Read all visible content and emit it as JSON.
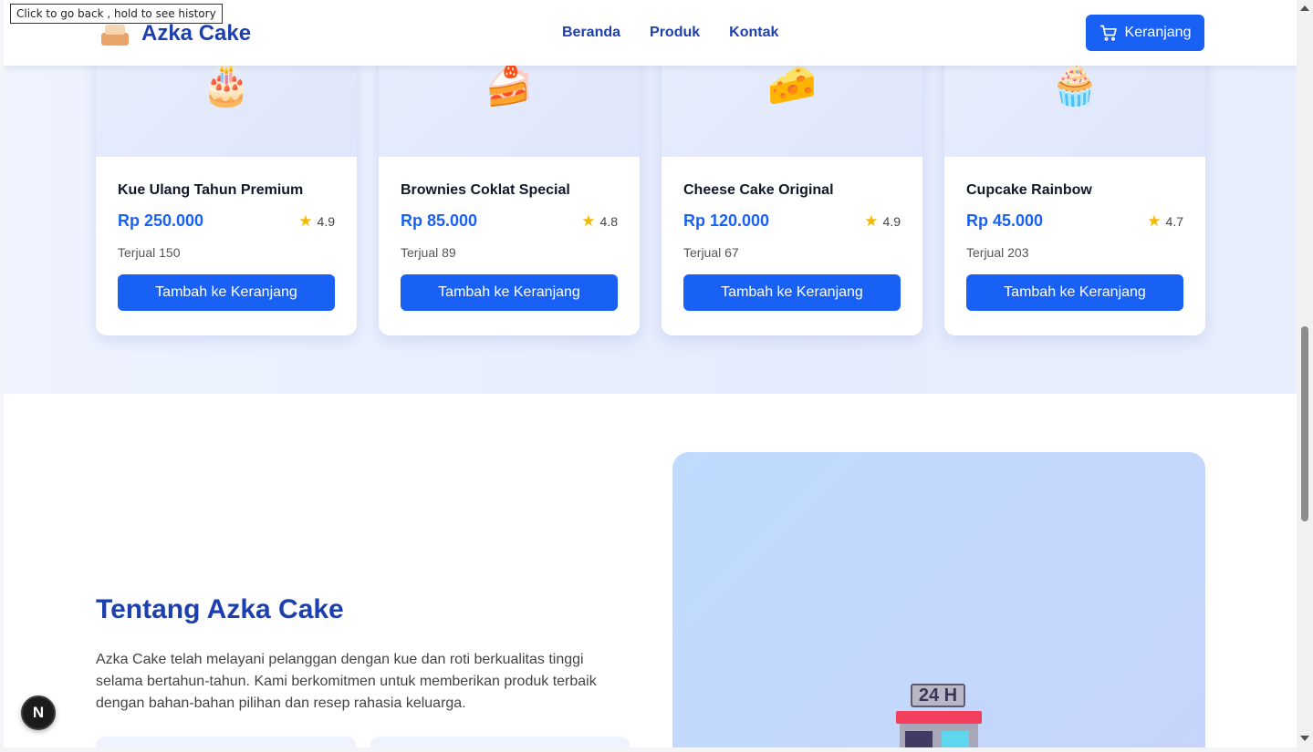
{
  "browser": {
    "tooltip": "Click to go back , hold to see history"
  },
  "header": {
    "brand": "Azka Cake",
    "nav": [
      "Beranda",
      "Produk",
      "Kontak"
    ],
    "cart_label": "Keranjang"
  },
  "products": [
    {
      "name": "Kue Ulang Tahun Premium",
      "price": "Rp 250.000",
      "rating": "4.9",
      "sold": "Terjual 150",
      "button": "Tambah ke Keranjang",
      "emoji": "🎂"
    },
    {
      "name": "Brownies Coklat Special",
      "price": "Rp 85.000",
      "rating": "4.8",
      "sold": "Terjual 89",
      "button": "Tambah ke Keranjang",
      "emoji": "🍰"
    },
    {
      "name": "Cheese Cake Original",
      "price": "Rp 120.000",
      "rating": "4.9",
      "sold": "Terjual 67",
      "button": "Tambah ke Keranjang",
      "emoji": "🧀"
    },
    {
      "name": "Cupcake Rainbow",
      "price": "Rp 45.000",
      "rating": "4.7",
      "sold": "Terjual 203",
      "button": "Tambah ke Keranjang",
      "emoji": "🧁"
    }
  ],
  "about": {
    "title": "Tentang Azka Cake",
    "description": "Azka Cake telah melayani pelanggan dengan kue dan roti berkualitas tinggi selama bertahun-tahun. Kami berkomitmen untuk memberikan produk terbaik dengan bahan-bahan pilihan dan resep rahasia keluarga.",
    "store_sign": "24 H"
  },
  "dev_badge": "N",
  "colors": {
    "primary": "#1961f5",
    "brand_text": "#1e40af",
    "star": "#f5b800"
  }
}
